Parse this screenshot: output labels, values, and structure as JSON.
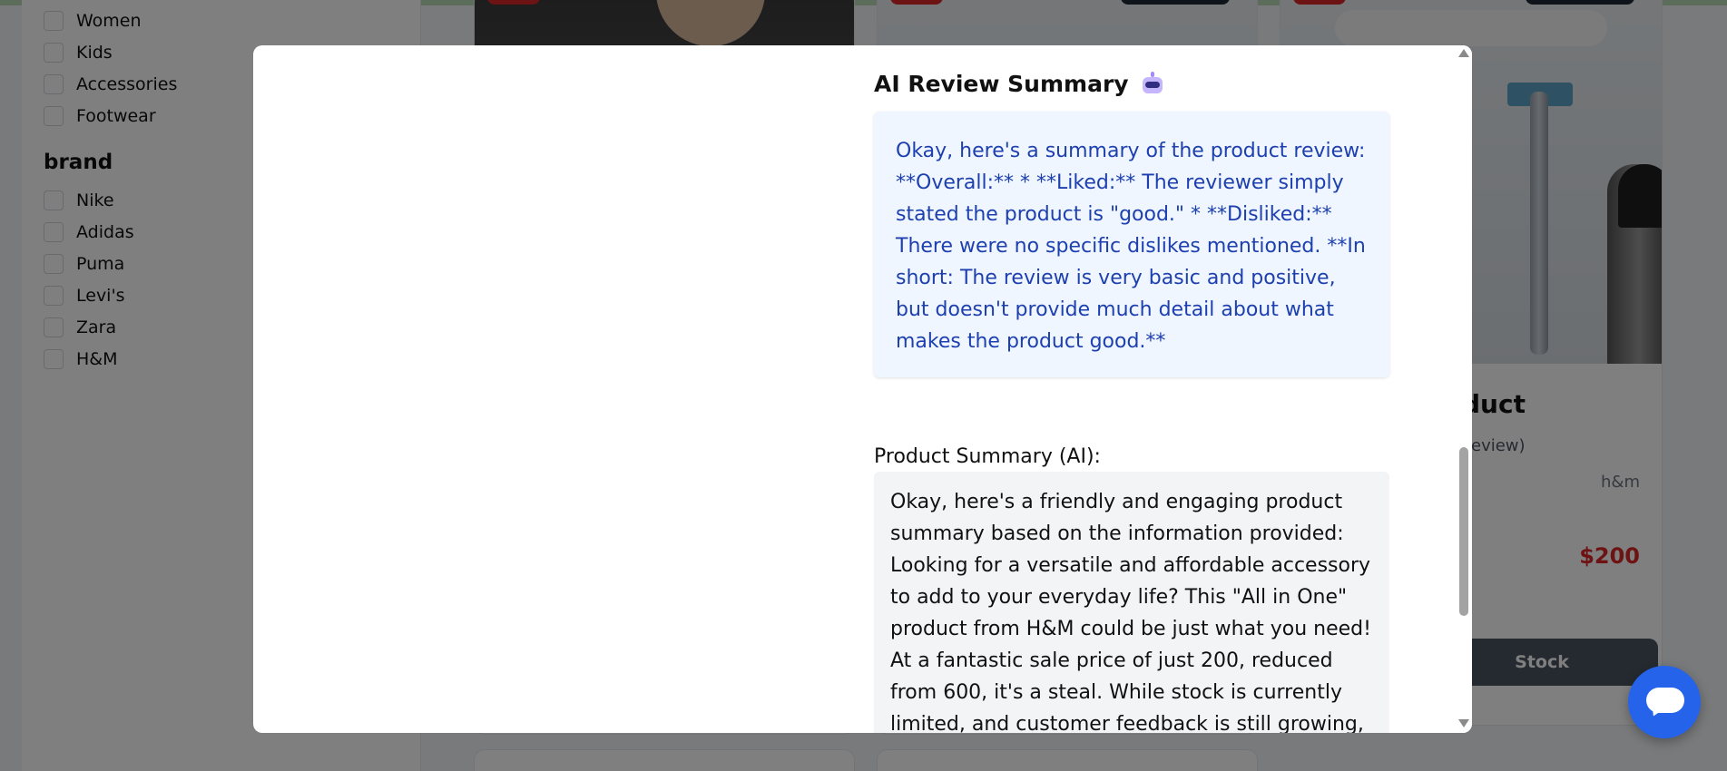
{
  "filters": {
    "categories": [
      "Women",
      "Kids",
      "Accessories",
      "Footwear"
    ],
    "brand_heading": "brand",
    "brands": [
      "Nike",
      "Adidas",
      "Puma",
      "Levi's",
      "Zara",
      "H&M"
    ]
  },
  "product_card": {
    "title_fragment": "duct",
    "reviews_fragment": "eview)",
    "brand": "h&m",
    "price": "$200",
    "button_fragment": "Stock"
  },
  "modal": {
    "review_title": "AI Review Summary",
    "review_text": "Okay, here's a summary of the product review: **Overall:** * **Liked:** The reviewer simply stated the product is \"good.\" * **Disliked:** There were no specific dislikes mentioned. **In short: The review is very basic and positive, but doesn't provide much detail about what makes the product good.**",
    "summary_label": "Product Summary (AI):",
    "summary_text": "Okay, here's a friendly and engaging product summary based on the information provided: Looking for a versatile and affordable accessory to add to your everyday life? This \"All in One\" product from H&M could be just what you need! At a fantastic sale price of just 200, reduced from 600, it's a steal. While stock is currently limited, and customer feedback is still growing, the recent"
  },
  "icons": {
    "robot": "robot-icon",
    "chat": "chat-icon"
  },
  "colors": {
    "review_box_bg": "#eff6ff",
    "review_text": "#1e40af",
    "price": "#dc2626",
    "chat_fab": "#2563eb"
  }
}
